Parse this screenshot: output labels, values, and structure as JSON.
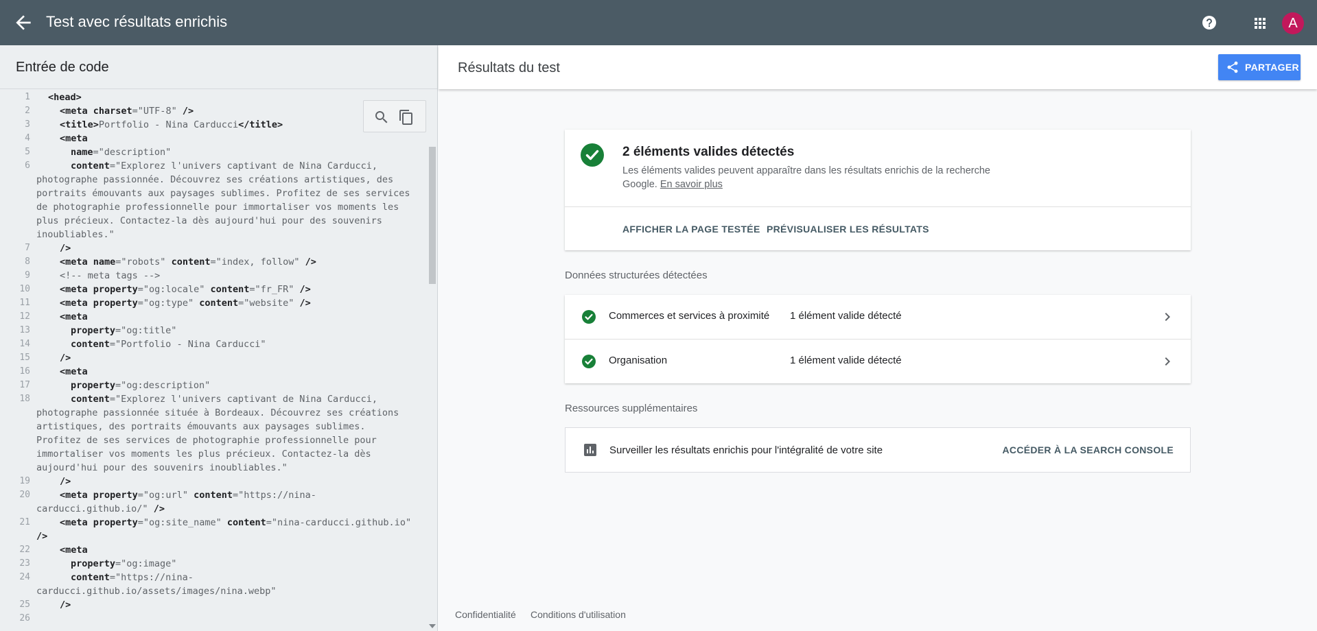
{
  "app": {
    "title": "Test avec résultats enrichis",
    "avatar_letter": "A"
  },
  "left": {
    "title": "Entrée de code",
    "code_lines": [
      {
        "n": "1",
        "html": "<b>&lt;head&gt;</b>",
        "indent": 1
      },
      {
        "n": "2",
        "html": "<b>&lt;meta charset</b>=\"UTF-8\" <b>/&gt;</b>",
        "indent": 2
      },
      {
        "n": "3",
        "html": "<b>&lt;title&gt;</b>Portfolio - Nina Carducci<b>&lt;/title&gt;</b>",
        "indent": 2
      },
      {
        "n": "4",
        "html": "<b>&lt;meta</b>",
        "indent": 2
      },
      {
        "n": "5",
        "html": "<b>name</b>=\"description\"",
        "indent": 3
      },
      {
        "n": "6",
        "html": "<b>content</b>=\"Explorez l'univers captivant de Nina Carducci,",
        "indent": 3
      },
      {
        "n": "",
        "html": "photographe passionnée. Découvrez ses créations artistiques, des",
        "indent": 0
      },
      {
        "n": "",
        "html": "portraits émouvants aux paysages sublimes. Profitez de ses services",
        "indent": 0
      },
      {
        "n": "",
        "html": "de photographie professionnelle pour immortaliser vos moments les",
        "indent": 0
      },
      {
        "n": "",
        "html": "plus précieux. Contactez-la dès aujourd'hui pour des souvenirs",
        "indent": 0
      },
      {
        "n": "",
        "html": "inoubliables.\"",
        "indent": 0
      },
      {
        "n": "7",
        "html": "<b>/&gt;</b>",
        "indent": 2
      },
      {
        "n": "8",
        "html": "<b>&lt;meta name</b>=\"robots\" <b>content</b>=\"index, follow\" <b>/&gt;</b>",
        "indent": 2
      },
      {
        "n": "9",
        "html": "&lt;!-- meta tags --&gt;",
        "indent": 2
      },
      {
        "n": "10",
        "html": "<b>&lt;meta property</b>=\"og:locale\" <b>content</b>=\"fr_FR\" <b>/&gt;</b>",
        "indent": 2
      },
      {
        "n": "11",
        "html": "<b>&lt;meta property</b>=\"og:type\" <b>content</b>=\"website\" <b>/&gt;</b>",
        "indent": 2
      },
      {
        "n": "12",
        "html": "<b>&lt;meta</b>",
        "indent": 2
      },
      {
        "n": "13",
        "html": "<b>property</b>=\"og:title\"",
        "indent": 3
      },
      {
        "n": "14",
        "html": "<b>content</b>=\"Portfolio - Nina Carducci\"",
        "indent": 3
      },
      {
        "n": "15",
        "html": "<b>/&gt;</b>",
        "indent": 2
      },
      {
        "n": "16",
        "html": "<b>&lt;meta</b>",
        "indent": 2
      },
      {
        "n": "17",
        "html": "<b>property</b>=\"og:description\"",
        "indent": 3
      },
      {
        "n": "18",
        "html": "<b>content</b>=\"Explorez l'univers captivant de Nina Carducci,",
        "indent": 3
      },
      {
        "n": "",
        "html": "photographe passionnée située à Bordeaux. Découvrez ses créations",
        "indent": 0
      },
      {
        "n": "",
        "html": "artistiques, des portraits émouvants aux paysages sublimes.",
        "indent": 0
      },
      {
        "n": "",
        "html": "Profitez de ses services de photographie professionnelle pour",
        "indent": 0
      },
      {
        "n": "",
        "html": "immortaliser vos moments les plus précieux. Contactez-la dès",
        "indent": 0
      },
      {
        "n": "",
        "html": "aujourd'hui pour des souvenirs inoubliables.\"",
        "indent": 0
      },
      {
        "n": "19",
        "html": "<b>/&gt;</b>",
        "indent": 2
      },
      {
        "n": "20",
        "html": "<b>&lt;meta property</b>=\"og:url\" <b>content</b>=\"https://nina-",
        "indent": 2
      },
      {
        "n": "",
        "html": "carducci.github.io/\" <b>/&gt;</b>",
        "indent": 0
      },
      {
        "n": "21",
        "html": "<b>&lt;meta property</b>=\"og:site_name\" <b>content</b>=\"nina-carducci.github.io\"",
        "indent": 2
      },
      {
        "n": "",
        "html": "<b>/&gt;</b>",
        "indent": 0
      },
      {
        "n": "22",
        "html": "<b>&lt;meta</b>",
        "indent": 2
      },
      {
        "n": "23",
        "html": "<b>property</b>=\"og:image\"",
        "indent": 3
      },
      {
        "n": "24",
        "html": "<b>content</b>=\"https://nina-",
        "indent": 3
      },
      {
        "n": "",
        "html": "carducci.github.io/assets/images/nina.webp\"",
        "indent": 0
      },
      {
        "n": "25",
        "html": "<b>/&gt;</b>",
        "indent": 2
      },
      {
        "n": "26",
        "html": "",
        "indent": 0
      }
    ]
  },
  "right": {
    "title": "Résultats du test",
    "share_label": "PARTAGER",
    "summary": {
      "title": "2 éléments valides détectés",
      "desc": "Les éléments valides peuvent apparaître dans les résultats enrichis de la recherche Google.",
      "learn_more": "En savoir plus",
      "action_view_page": "AFFICHER LA PAGE TESTÉE",
      "action_preview": "PRÉVISUALISER LES RÉSULTATS"
    },
    "structured_label": "Données structurées détectées",
    "items": [
      {
        "name": "Commerces et services à proximité",
        "status": "1 élément valide détecté"
      },
      {
        "name": "Organisation",
        "status": "1 élément valide détecté"
      }
    ],
    "resources_label": "Ressources supplémentaires",
    "resource": {
      "text": "Surveiller les résultats enrichis pour l'intégralité de votre site",
      "link": "ACCÉDER À LA SEARCH CONSOLE"
    }
  },
  "footer": {
    "privacy": "Confidentialité",
    "terms": "Conditions d'utilisation"
  },
  "colors": {
    "topbar": "#4b5b65",
    "success_green": "#188038",
    "accent_blue": "#4285f4",
    "avatar": "#c2185b"
  },
  "icons": [
    "arrow-back-icon",
    "help-icon",
    "apps-grid-icon",
    "search-icon",
    "copy-icon",
    "share-icon",
    "check-circle-icon",
    "chevron-right-icon",
    "bar-chart-icon"
  ]
}
